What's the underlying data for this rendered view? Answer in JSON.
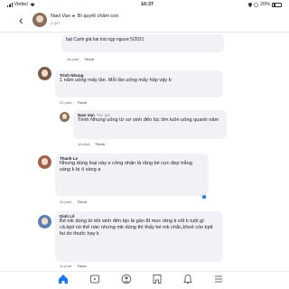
{
  "status_bar": {
    "carrier": "Viettel",
    "time": "10:37",
    "battery": "20%"
  },
  "header": {
    "page_name": "Navi Van",
    "post_title": "Bí quyết chăm con",
    "subtitle": "2 giờ"
  },
  "comments": [
    {
      "text": "bạt Cạnh giá hai trái ngp nguoe 5/2021",
      "time": "44 phút",
      "like": "Thích"
    },
    {
      "name": "Trinh Nhung",
      "text": "1 năm uống mấy lần. Mỗi lần uống mấy hộp vậy b",
      "time": "22 phút",
      "like": "Thích"
    },
    {
      "name": "Navi Van",
      "tag": "Tác giả",
      "text": "Trinh Nhung uống từ sơ sinh đến lúc lớn luôn uống quanh năm",
      "time": "18 phút",
      "like": "Thích"
    },
    {
      "name": "Thanh Le",
      "text": "Nhưng dùng loại này e công nhận là răng bé cực đẹp trắng sáng k bị ố vàng ạ",
      "time": "20 phút",
      "like": "Thích"
    },
    {
      "name": "Dinh Lê",
      "text": "Bé mk dùng từ khi sinh đến bjo là gần 8t mọc răng k sốt k tuột gì cả.kpit nó thế nào nhưng mk dùng thì thấy bé mk chắc,khoẻ còn kpit fai do thuốc hay k",
      "time": "11 phút",
      "like": "Thích"
    }
  ],
  "bottom_nav": [
    "home-icon",
    "watch-icon",
    "profile-icon",
    "marketplace-icon",
    "notifications-icon",
    "menu-icon"
  ],
  "colors": {
    "accent": "#1877f2",
    "bubble": "#f0f2f5"
  }
}
